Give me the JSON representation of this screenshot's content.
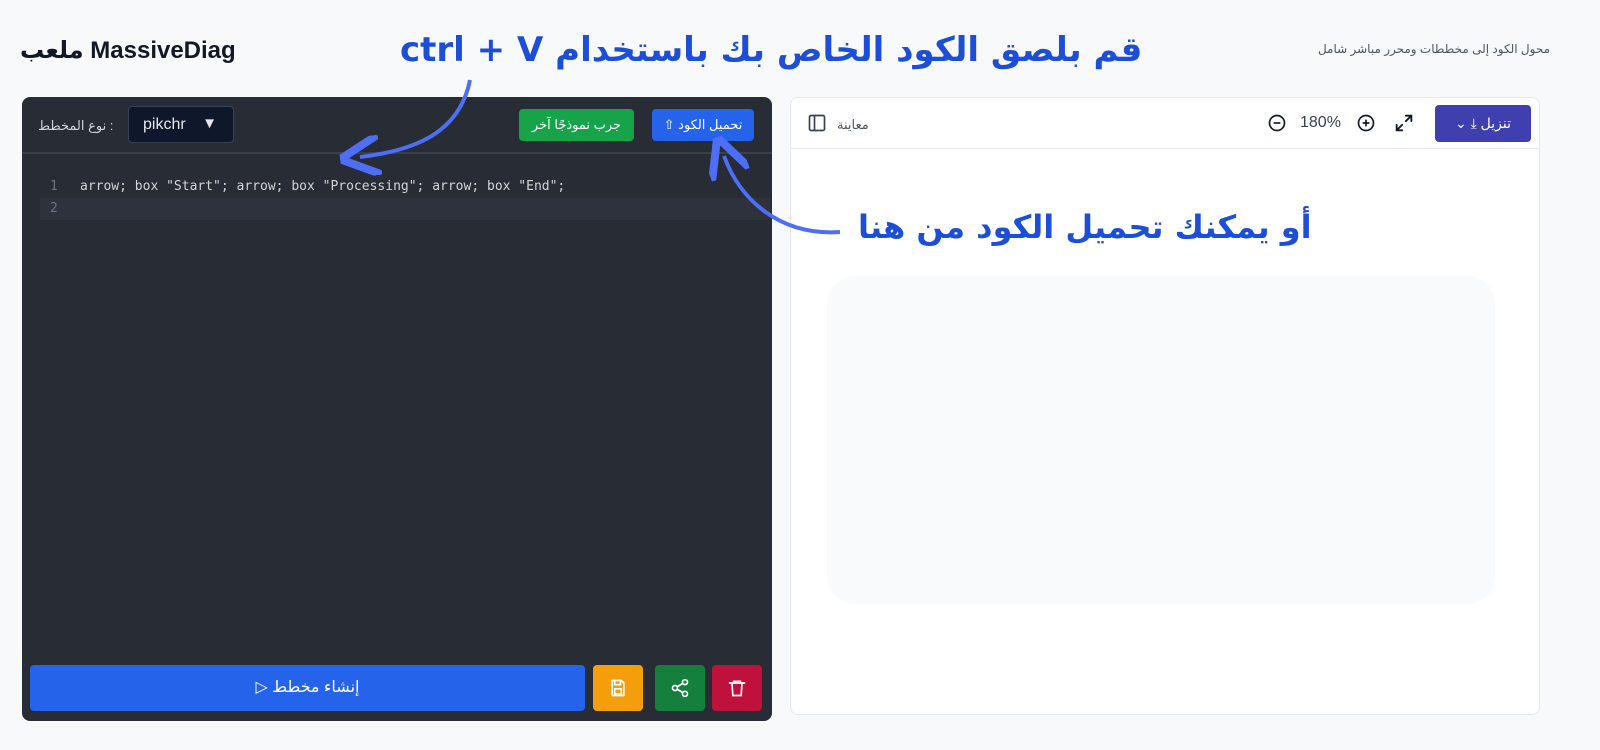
{
  "header": {
    "brand": "MassiveDiag ملعب",
    "tagline": "محول الكود إلى مخططات ومحرر مباشر شامل"
  },
  "annotations": {
    "paste_hint": "قم بلصق الكود الخاص بك باستخدام ctrl + V",
    "upload_hint": "أو يمكنك تحميل الكود من هنا"
  },
  "editor": {
    "type_label": ": نوع المخطط",
    "type_value": "pikchr",
    "sample_button": "جرب نموذجًا آخر",
    "upload_button": "تحميل الكود ⇧",
    "lines": [
      {
        "num": "1",
        "text": "arrow; box \"Start\"; arrow; box \"Processing\"; arrow; box \"End\";"
      },
      {
        "num": "2",
        "text": ""
      }
    ],
    "generate_button": "إنشاء مخطط ▷"
  },
  "preview": {
    "label": "معاينة",
    "zoom": "180%",
    "download_button": "تنزيل ⤓ ⌄"
  },
  "colors": {
    "accent_blue": "#2563eb",
    "annotation_blue": "#1d4ed8",
    "success_green": "#16a34a",
    "warning_orange": "#f59e0b",
    "danger_red": "#be123c",
    "download_indigo": "#3f3fb0",
    "editor_bg": "#282c34"
  }
}
